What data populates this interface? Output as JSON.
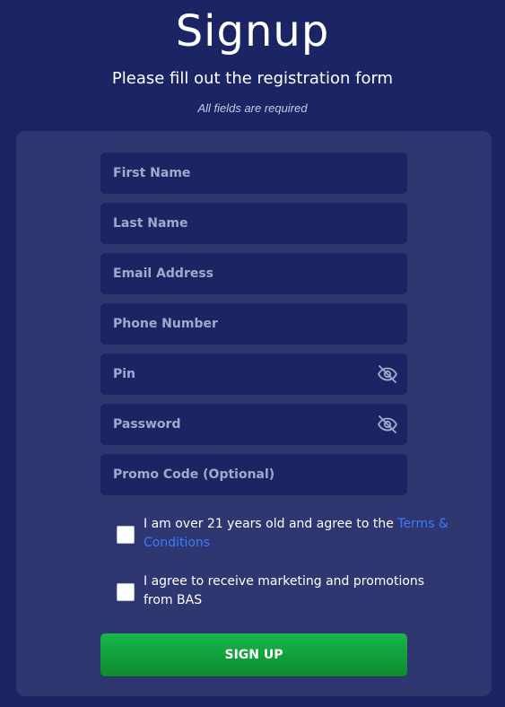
{
  "header": {
    "title": "Signup",
    "subtitle": "Please fill out the registration form",
    "note": "All fields are required"
  },
  "form": {
    "first_name": {
      "placeholder": "First Name",
      "value": ""
    },
    "last_name": {
      "placeholder": "Last Name",
      "value": ""
    },
    "email": {
      "placeholder": "Email Address",
      "value": ""
    },
    "phone": {
      "placeholder": "Phone Number",
      "value": ""
    },
    "pin": {
      "placeholder": "Pin",
      "value": "",
      "icon": "eye-slash-icon"
    },
    "password": {
      "placeholder": "Password",
      "value": "",
      "icon": "eye-slash-icon"
    },
    "promo": {
      "placeholder": "Promo Code (Optional)",
      "value": ""
    }
  },
  "agreements": {
    "age_text": "I am over 21 years old and agree to the ",
    "terms_link": "Terms & Conditions",
    "age_checked": false,
    "marketing_text": "I agree to receive marketing and promotions from BAS",
    "marketing_checked": false
  },
  "submit": {
    "label": "SIGN UP"
  },
  "colors": {
    "background": "#1b2563",
    "card": "#2e376f",
    "input": "#1b2563",
    "link": "#3a7bff",
    "button": "#12a23c"
  }
}
